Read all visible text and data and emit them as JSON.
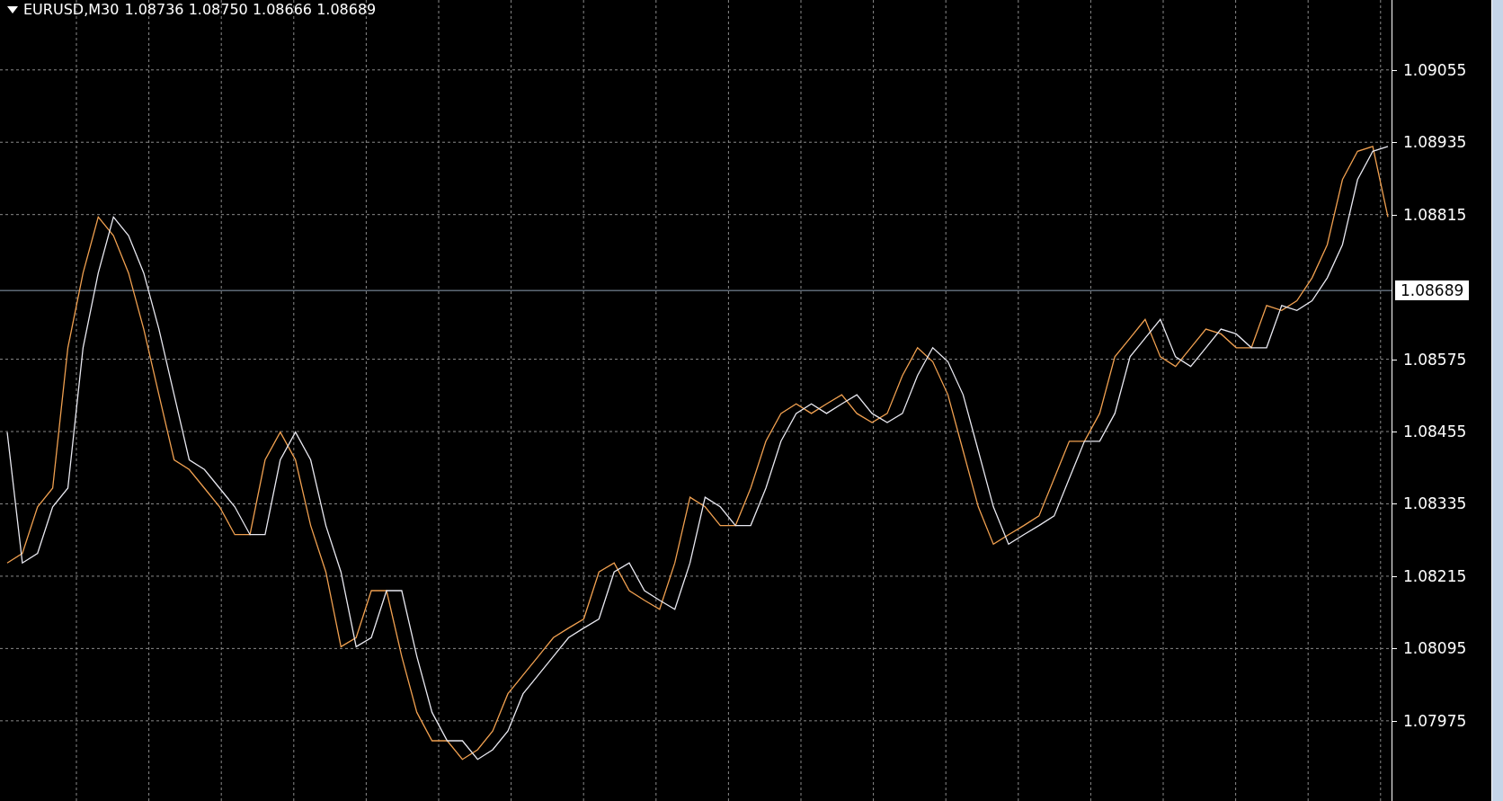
{
  "header": {
    "symbol": "EURUSD,M30",
    "quote": "1.08736 1.08750 1.08666 1.08689"
  },
  "chart": {
    "chart_data": {
      "type": "line",
      "grid": true,
      "ylim": [
        1.07842,
        1.09171
      ],
      "ref_lines": [
        {
          "axis": "y",
          "value": 1.08689,
          "label": "1.08689"
        }
      ],
      "categories": [
        null,
        null,
        null,
        null,
        null,
        null,
        null,
        null,
        null,
        null,
        null,
        null,
        null,
        null,
        null,
        null,
        null,
        null,
        null,
        null,
        null,
        null,
        null,
        null,
        null,
        null,
        null,
        null,
        null,
        null,
        null,
        null,
        null,
        null,
        null,
        null,
        null,
        null,
        null,
        null,
        null,
        null,
        null,
        null,
        null,
        null,
        null,
        null,
        null,
        null,
        null,
        null,
        null,
        null,
        null,
        null,
        null,
        null,
        null,
        null,
        null,
        null,
        null,
        null,
        null,
        null,
        null,
        null,
        null,
        null,
        null,
        null,
        null,
        null,
        null,
        null,
        null,
        null,
        null,
        null,
        null,
        null,
        null,
        null,
        null,
        null,
        null,
        null,
        null,
        null,
        null,
        null
      ],
      "series": [
        {
          "color": "#f0a050",
          "values": [
            1.08237,
            1.08253,
            1.0833,
            1.08361,
            1.08594,
            1.08718,
            1.08811,
            1.0878,
            1.08718,
            1.08625,
            1.08516,
            1.08408,
            1.08392,
            1.08361,
            1.0833,
            1.08284,
            1.08284,
            1.08408,
            1.08454,
            1.08408,
            1.08299,
            1.08222,
            1.08098,
            1.08113,
            1.08191,
            1.08191,
            1.08082,
            1.07989,
            1.07942,
            1.07942,
            1.07911,
            1.07927,
            1.07958,
            1.0802,
            1.08051,
            1.08082,
            1.08113,
            1.08129,
            1.08144,
            1.08222,
            1.08237,
            1.08191,
            1.08175,
            1.0816,
            1.08237,
            1.08346,
            1.0833,
            1.08299,
            1.08299,
            1.08361,
            1.08439,
            1.08485,
            1.08501,
            1.08485,
            1.08501,
            1.08516,
            1.08485,
            1.0847,
            1.08485,
            1.08548,
            1.08594,
            1.08571,
            1.08516,
            1.08423,
            1.0833,
            1.08268,
            1.08284,
            1.08299,
            1.08315,
            1.08377,
            1.08439,
            1.08439,
            1.08485,
            1.08579,
            1.0861,
            1.08641,
            1.08579,
            1.08563,
            1.08594,
            1.08625,
            1.08617,
            1.08594,
            1.08594,
            1.08664,
            1.08656,
            1.08672,
            1.0871,
            1.08765,
            1.08873,
            1.0892,
            1.08928,
            1.08811
          ]
        },
        {
          "color": "#e8e8f0",
          "values": [
            1.08454,
            1.08237,
            1.08253,
            1.0833,
            1.08361,
            1.08594,
            1.08718,
            1.08811,
            1.0878,
            1.08718,
            1.08625,
            1.08516,
            1.08408,
            1.08392,
            1.08361,
            1.0833,
            1.08284,
            1.08284,
            1.08408,
            1.08454,
            1.08408,
            1.08299,
            1.08222,
            1.08098,
            1.08113,
            1.08191,
            1.08191,
            1.08082,
            1.07989,
            1.07942,
            1.07942,
            1.07911,
            1.07927,
            1.07958,
            1.0802,
            1.08051,
            1.08082,
            1.08113,
            1.08129,
            1.08144,
            1.08222,
            1.08237,
            1.08191,
            1.08175,
            1.0816,
            1.08237,
            1.08346,
            1.0833,
            1.08299,
            1.08299,
            1.08361,
            1.08439,
            1.08485,
            1.08501,
            1.08485,
            1.08501,
            1.08516,
            1.08485,
            1.0847,
            1.08485,
            1.08548,
            1.08594,
            1.08571,
            1.08516,
            1.08423,
            1.0833,
            1.08268,
            1.08284,
            1.08299,
            1.08315,
            1.08377,
            1.08439,
            1.08439,
            1.08485,
            1.08579,
            1.0861,
            1.08641,
            1.08579,
            1.08563,
            1.08594,
            1.08625,
            1.08617,
            1.08594,
            1.08594,
            1.08664,
            1.08656,
            1.08672,
            1.0871,
            1.08765,
            1.08873,
            1.0892,
            1.08928
          ]
        }
      ],
      "yticks": [
        {
          "value": 1.07975,
          "label": "1.07975"
        },
        {
          "value": 1.08095,
          "label": "1.08095"
        },
        {
          "value": 1.08215,
          "label": "1.08215"
        },
        {
          "value": 1.08335,
          "label": "1.08335"
        },
        {
          "value": 1.08455,
          "label": "1.08455"
        },
        {
          "value": 1.08575,
          "label": "1.08575"
        },
        {
          "value": 1.08815,
          "label": "1.08815"
        },
        {
          "value": 1.08935,
          "label": "1.08935"
        },
        {
          "value": 1.09055,
          "label": "1.09055"
        }
      ]
    }
  }
}
